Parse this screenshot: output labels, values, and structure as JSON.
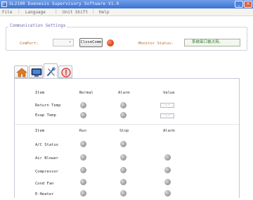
{
  "window": {
    "title": "SL2100 Duenesis Supervisory Software V1.0",
    "minimize_glyph": "_",
    "close_glyph": "×"
  },
  "menu": {
    "items": [
      "File",
      "Language",
      "Unit Shift",
      "Help"
    ],
    "separator": "|"
  },
  "communication": {
    "legend": "Communication Settings",
    "port_label": "ComPort:",
    "port_value": "",
    "port_arrow": "▾",
    "close_button": "CloseComm",
    "status_led_color": "#e04a1e",
    "monitor_label": "Monitor Status:",
    "monitor_value": "系统串口被占用。"
  },
  "tabs": [
    {
      "icon": "home-icon",
      "active": false
    },
    {
      "icon": "monitor-icon",
      "active": false
    },
    {
      "icon": "tools-icon",
      "active": true
    },
    {
      "icon": "alarm-icon",
      "active": false
    }
  ],
  "table1": {
    "headers": [
      "Item",
      "Normal",
      "Alarm",
      "Value"
    ],
    "rows": [
      {
        "label": "Return Temp",
        "value": "--.--"
      },
      {
        "label": "Evap Temp",
        "value": "--.--"
      }
    ]
  },
  "table2": {
    "headers": [
      "Item",
      "Run",
      "Stop",
      "Alarm"
    ],
    "rows": [
      {
        "label": "A/C Status",
        "has_alarm": false
      },
      {
        "label": "Air Blower",
        "has_alarm": true
      },
      {
        "label": "Compressor",
        "has_alarm": true
      },
      {
        "label": "Cond Fan",
        "has_alarm": true
      },
      {
        "label": "E-Heater",
        "has_alarm": true
      }
    ]
  },
  "colors": {
    "title_bar": "#3d72d4",
    "indicator_off": "#9c9c9c",
    "status_text": "#2d7a2d",
    "label_orange": "#b06c2e"
  }
}
